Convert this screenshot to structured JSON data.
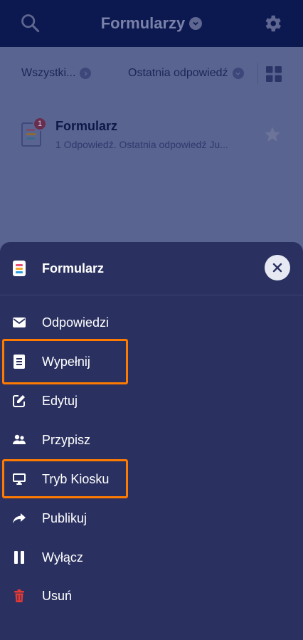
{
  "appbar": {
    "title": "Formularzy"
  },
  "filters": {
    "left_label": "Wszystki...",
    "right_label": "Ostatnia odpowiedź"
  },
  "list": {
    "item": {
      "title": "Formularz",
      "subtitle": "1 Odpowiedź. Ostatnia odpowiedź Ju...",
      "badge": "1"
    }
  },
  "sheet": {
    "title": "Formularz",
    "items": [
      {
        "label": "Odpowiedzi",
        "icon": "mail-icon"
      },
      {
        "label": "Wypełnij",
        "icon": "document-icon",
        "highlighted": true
      },
      {
        "label": "Edytuj",
        "icon": "edit-icon"
      },
      {
        "label": "Przypisz",
        "icon": "people-icon"
      },
      {
        "label": "Tryb Kiosku",
        "icon": "monitor-icon",
        "highlighted": true
      },
      {
        "label": "Publikuj",
        "icon": "share-arrow-icon"
      },
      {
        "label": "Wyłącz",
        "icon": "pause-icon"
      },
      {
        "label": "Usuń",
        "icon": "trash-icon"
      }
    ]
  },
  "colors": {
    "highlight": "#ff7a00",
    "delete": "#e53935",
    "sheet_bg": "#2a3160",
    "appbar_bg": "#0c1850"
  }
}
